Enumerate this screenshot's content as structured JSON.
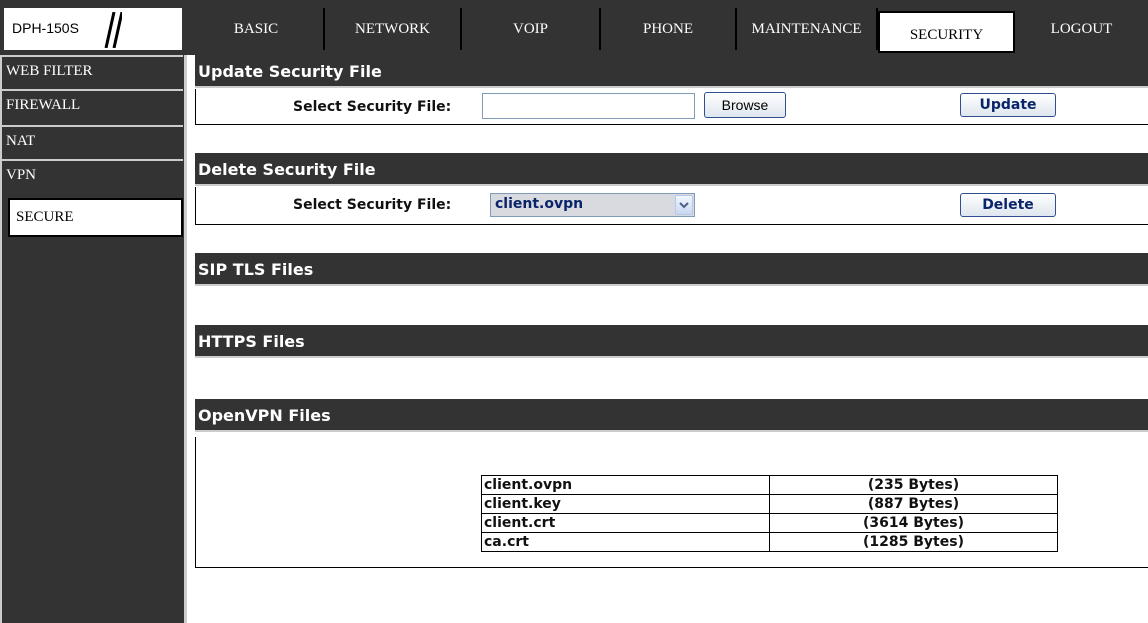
{
  "device": {
    "model": "DPH-150S"
  },
  "nav": {
    "tabs": [
      {
        "label": "BASIC"
      },
      {
        "label": "NETWORK"
      },
      {
        "label": "VOIP"
      },
      {
        "label": "PHONE"
      },
      {
        "label": "MAINTENANCE"
      },
      {
        "label": "SECURITY",
        "active": true
      },
      {
        "label": "LOGOUT"
      }
    ]
  },
  "sidebar": {
    "items": [
      {
        "label": "WEB FILTER"
      },
      {
        "label": "FIREWALL"
      },
      {
        "label": "NAT"
      },
      {
        "label": "VPN"
      },
      {
        "label": "SECURE",
        "active": true
      }
    ]
  },
  "update_section": {
    "title": "Update Security File",
    "field_label": "Select Security File:",
    "file_value": "",
    "browse_label": "Browse",
    "update_label": "Update"
  },
  "delete_section": {
    "title": "Delete Security File",
    "field_label": "Select Security File:",
    "selected_file": "client.ovpn",
    "delete_label": "Delete"
  },
  "sip_tls": {
    "title": "SIP TLS Files"
  },
  "https": {
    "title": "HTTPS Files"
  },
  "openvpn": {
    "title": "OpenVPN Files",
    "files": [
      {
        "name": "client.ovpn",
        "size": "(235 Bytes)"
      },
      {
        "name": "client.key",
        "size": "(887 Bytes)"
      },
      {
        "name": "client.crt",
        "size": "(3614 Bytes)"
      },
      {
        "name": "ca.crt",
        "size": "(1285 Bytes)"
      }
    ]
  },
  "colors": {
    "dark": "#333333",
    "light_border": "#cccccc",
    "button_text": "#0a246a"
  }
}
